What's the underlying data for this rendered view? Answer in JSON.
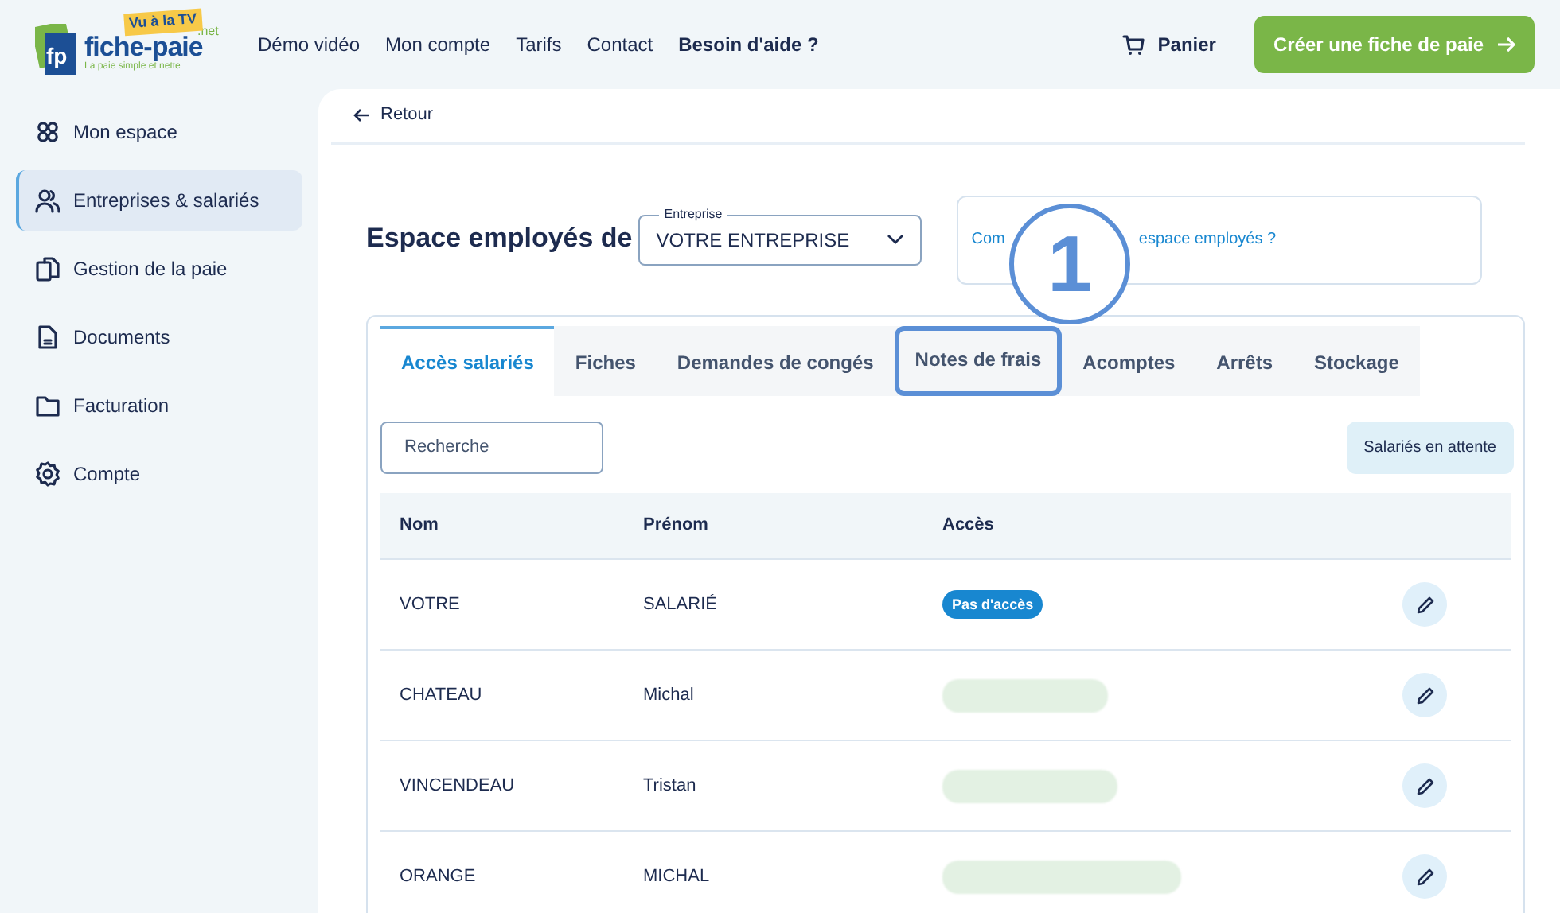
{
  "logo": {
    "mark": "fp",
    "name": "fiche-paie",
    "suffix": ".net",
    "badge": "Vu à la TV",
    "tagline": "La paie simple et nette"
  },
  "nav": [
    "Démo vidéo",
    "Mon compte",
    "Tarifs",
    "Contact",
    "Besoin d'aide ?"
  ],
  "cart": "Panier",
  "cta": "Créer une fiche de paie",
  "sidebar": {
    "items": [
      {
        "label": "Mon espace",
        "selected": false
      },
      {
        "label": "Entreprises & salariés",
        "selected": true
      },
      {
        "label": "Gestion de la paie",
        "selected": false
      },
      {
        "label": "Documents",
        "selected": false
      },
      {
        "label": "Facturation",
        "selected": false
      },
      {
        "label": "Compte",
        "selected": false
      }
    ]
  },
  "back": "Retour",
  "heading": "Espace employés de",
  "company_select": {
    "label": "Entreprise",
    "value": "VOTRE ENTREPRISE"
  },
  "help_link": [
    "Com",
    "espace employés ?"
  ],
  "annotation": {
    "number": "1"
  },
  "tabs": [
    {
      "label": "Accès salariés",
      "selected": true,
      "highlighted": false
    },
    {
      "label": "Fiches",
      "selected": false,
      "highlighted": false
    },
    {
      "label": "Demandes de congés",
      "selected": false,
      "highlighted": false
    },
    {
      "label": "Notes de frais",
      "selected": false,
      "highlighted": true
    },
    {
      "label": "Acomptes",
      "selected": false,
      "highlighted": false
    },
    {
      "label": "Arrêts",
      "selected": false,
      "highlighted": false
    },
    {
      "label": "Stockage",
      "selected": false,
      "highlighted": false
    }
  ],
  "search": {
    "placeholder": "Recherche"
  },
  "pending_button": "Salariés en attente",
  "table": {
    "columns": [
      "Nom",
      "Prénom",
      "Accès"
    ],
    "rows": [
      {
        "nom": "VOTRE",
        "prenom": "SALARIÉ",
        "access": {
          "kind": "badge",
          "text": "Pas d'accès"
        }
      },
      {
        "nom": "CHATEAU",
        "prenom": "Michal",
        "access": {
          "kind": "blurred"
        }
      },
      {
        "nom": "VINCENDEAU",
        "prenom": "Tristan",
        "access": {
          "kind": "blurred"
        }
      },
      {
        "nom": "ORANGE",
        "prenom": "MICHAL",
        "access": {
          "kind": "blurred"
        }
      }
    ]
  }
}
